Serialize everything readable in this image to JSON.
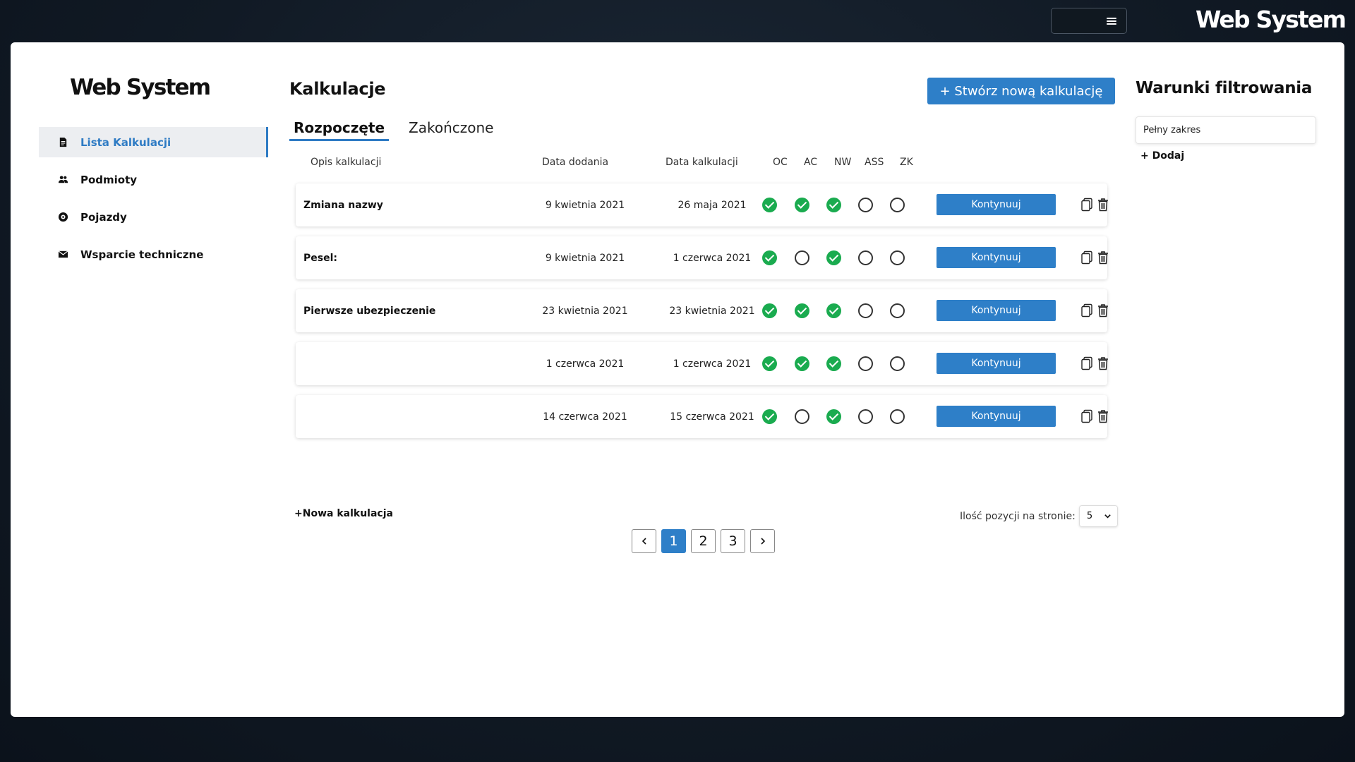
{
  "topbar": {
    "logo": "Web System",
    "menu_icon": "hamburger-icon"
  },
  "brand": {
    "name": "Web System"
  },
  "sidebar": {
    "items": [
      {
        "label": "Lista Kalkulacji",
        "icon": "document-icon",
        "active": true
      },
      {
        "label": "Podmioty",
        "icon": "users-icon",
        "active": false
      },
      {
        "label": "Pojazdy",
        "icon": "tire-icon",
        "active": false
      },
      {
        "label": "Wsparcie techniczne",
        "icon": "envelope-icon",
        "active": false
      }
    ]
  },
  "main": {
    "title": "Kalkulacje",
    "create_button": "+ Stwórz nową kalkulację",
    "tabs": [
      {
        "label": "Rozpoczęte",
        "active": true
      },
      {
        "label": "Zakończone",
        "active": false
      }
    ],
    "columns": {
      "desc": "Opis kalkulacji",
      "added": "Data dodania",
      "calc": "Data kalkulacji",
      "oc": "OC",
      "ac": "AC",
      "nw": "NW",
      "ass": "ASS",
      "zk": "ZK"
    },
    "rows": [
      {
        "desc": "Zmiana nazwy",
        "added": "9 kwietnia 2021",
        "calc": "26 maja 2021",
        "status": [
          true,
          true,
          true,
          false,
          false
        ],
        "action": "Kontynuuj"
      },
      {
        "desc": "Pesel:",
        "added": "9 kwietnia 2021",
        "calc": "1 czerwca 2021",
        "status": [
          true,
          false,
          true,
          false,
          false
        ],
        "action": "Kontynuuj"
      },
      {
        "desc": "Pierwsze ubezpieczenie",
        "added": "23 kwietnia 2021",
        "calc": "23 kwietnia 2021",
        "status": [
          true,
          true,
          true,
          false,
          false
        ],
        "action": "Kontynuuj"
      },
      {
        "desc": "",
        "added": "1 czerwca 2021",
        "calc": "1 czerwca 2021",
        "status": [
          true,
          true,
          true,
          false,
          false
        ],
        "action": "Kontynuuj"
      },
      {
        "desc": "",
        "added": "14 czerwca 2021",
        "calc": "15 czerwca 2021",
        "status": [
          true,
          false,
          true,
          false,
          false
        ],
        "action": "Kontynuuj"
      }
    ],
    "new_link": "+Nowa kalkulacja",
    "pagination": {
      "pages": [
        "1",
        "2",
        "3"
      ],
      "current": "1",
      "prev_icon": "chevron-left-icon",
      "next_icon": "chevron-right-icon"
    },
    "per_page": {
      "label": "Ilość pozycji na stronie:",
      "value": "5"
    }
  },
  "filters": {
    "title": "Warunki filtrowania",
    "range": "Pełny zakres",
    "add": "+ Dodaj"
  },
  "colors": {
    "accent": "#2e7fc8",
    "success": "#1aab4f",
    "background": "#111a25"
  }
}
